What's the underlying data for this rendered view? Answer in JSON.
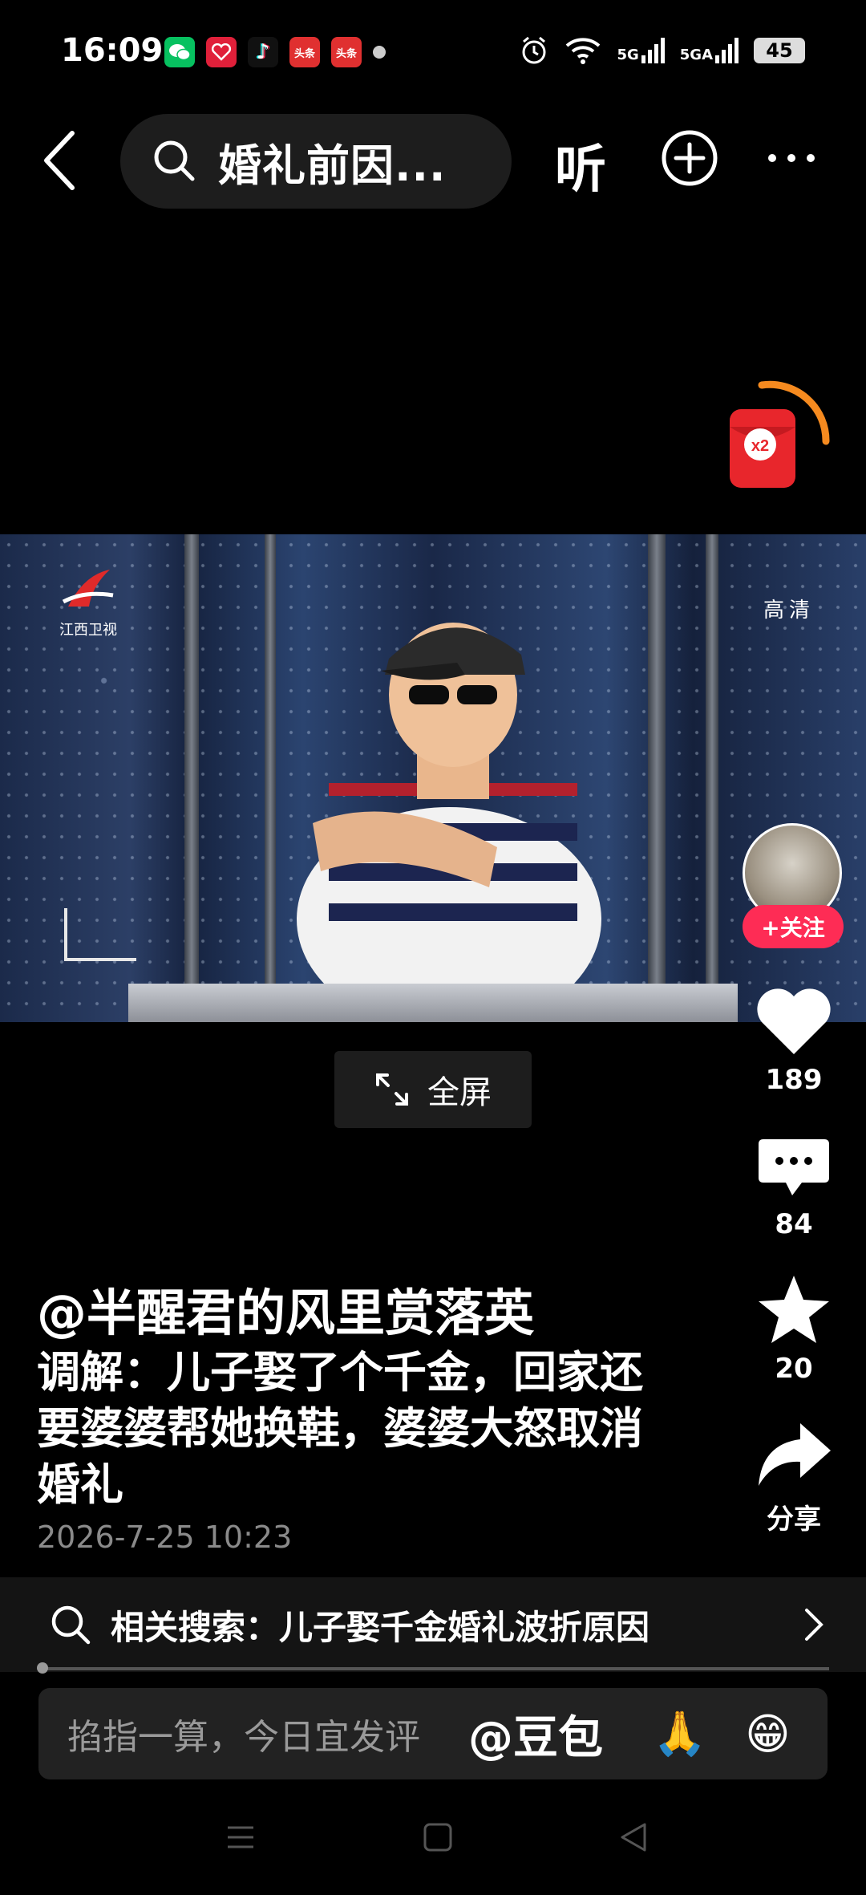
{
  "status_bar": {
    "time": "16:09",
    "apps": [
      {
        "name": "wechat",
        "label": "",
        "color": "#07c160"
      },
      {
        "name": "redbook",
        "label": "",
        "color": "#e0203a"
      },
      {
        "name": "douyin",
        "label": "♪",
        "color": "#111111"
      },
      {
        "name": "toutiao1",
        "label": "头条",
        "color": "#e03030"
      },
      {
        "name": "toutiao2",
        "label": "头条",
        "color": "#e03030"
      }
    ],
    "network1": "5G",
    "network2": "5GA",
    "battery": "45"
  },
  "nav": {
    "search_text": "婚礼前因...",
    "listen_label": "听"
  },
  "video": {
    "channel_name": "江西卫视",
    "quality_badge": "高清"
  },
  "actions": {
    "follow_label": "+关注",
    "like_count": "189",
    "comment_count": "84",
    "favorite_count": "20",
    "share_label": "分享"
  },
  "fullscreen_label": "全屏",
  "post": {
    "author": "@半醒君的风里赏落英",
    "description": "调解：儿子娶了个千金，回家还要婆婆帮她换鞋，婆婆大怒取消婚礼",
    "date": "2026-7-25 10:23"
  },
  "related_search": "相关搜索：儿子娶千金婚礼波折原因",
  "comment": {
    "placeholder": "掐指一算，今日宜发评",
    "mention": "@豆包",
    "emoji1": "🙏",
    "emoji2": "😁"
  },
  "colors": {
    "accent": "#fe2c55",
    "redpack": "#e8262c"
  },
  "redpack_label": "x2"
}
